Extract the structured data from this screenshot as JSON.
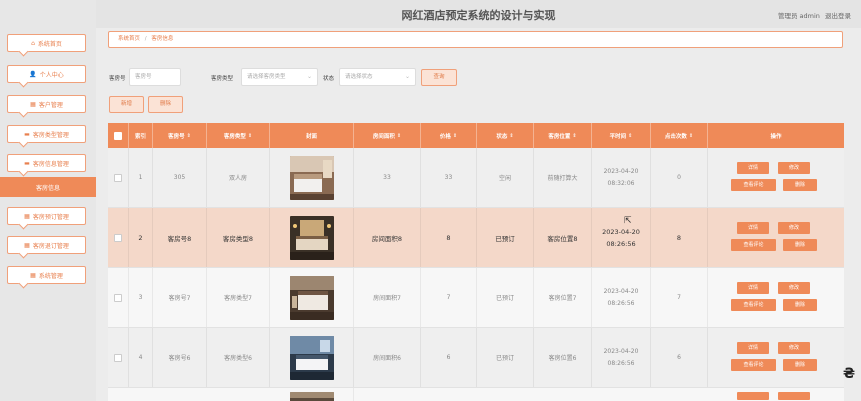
{
  "header": {
    "title": "网红酒店预定系统的设计与实现",
    "user_label": "管理员 admin",
    "logout": "退出登录"
  },
  "sidebar": {
    "items": [
      {
        "label": "系统首页",
        "icon": "home-icon",
        "glyph": "⌂"
      },
      {
        "label": "个人中心",
        "icon": "person-icon",
        "glyph": "👤"
      },
      {
        "label": "客户管理",
        "icon": "grid-icon",
        "glyph": "▦"
      },
      {
        "label": "客房类型管理",
        "icon": "monitor-icon",
        "glyph": "▬"
      },
      {
        "label": "客房信息管理",
        "icon": "monitor-icon",
        "glyph": "▬"
      },
      {
        "label": "客房信息",
        "icon": "",
        "glyph": ""
      },
      {
        "label": "客房预订管理",
        "icon": "grid-icon",
        "glyph": "▦"
      },
      {
        "label": "客房退订管理",
        "icon": "grid-icon",
        "glyph": "▦"
      },
      {
        "label": "系统管理",
        "icon": "grid-icon",
        "glyph": "▦"
      }
    ]
  },
  "breadcrumb": {
    "home": "系统首页",
    "sep": "/",
    "current": "客房信息"
  },
  "search": {
    "room_no_label": "客房号",
    "room_no_placeholder": "客房号",
    "type_label": "客房类型",
    "type_placeholder": "请选择客房类型",
    "status_label": "状态",
    "status_placeholder": "请选择状态",
    "query_button": "查询",
    "add_button": "新增",
    "delete_button": "删除"
  },
  "table": {
    "headers": {
      "index": "索引",
      "room_no": "客房号",
      "room_type": "客房类型",
      "cover": "封面",
      "area": "房间面积",
      "price": "价格",
      "status": "状态",
      "location": "客房位置",
      "time": "平时间",
      "clicks": "点击次数",
      "actions": "操作"
    },
    "sort_glyph": "⇕",
    "actions": {
      "detail": "详情",
      "edit": "修改",
      "view_reviews": "查看评论",
      "delete": "删除"
    },
    "rows": [
      {
        "index": "1",
        "room_no": "305",
        "room_type": "双人房",
        "area": "33",
        "price": "33",
        "status": "空闲",
        "location": "前随打算大",
        "time": "2023-04-20 08:32:06",
        "clicks": "0"
      },
      {
        "index": "2",
        "room_no": "客房号8",
        "room_type": "客房类型8",
        "area": "房间面积8",
        "price": "8",
        "status": "已预订",
        "location": "客房位置8",
        "time": "2023-04-20 08:26:56",
        "clicks": "8"
      },
      {
        "index": "3",
        "room_no": "客房号7",
        "room_type": "客房类型7",
        "area": "房间面积7",
        "price": "7",
        "status": "已预订",
        "location": "客房位置7",
        "time": "2023-04-20 08:26:56",
        "clicks": "7"
      },
      {
        "index": "4",
        "room_no": "客房号6",
        "room_type": "客房类型6",
        "area": "房间面积6",
        "price": "6",
        "status": "已预订",
        "location": "客房位置6",
        "time": "2023-04-20 08:26:56",
        "clicks": "6"
      }
    ]
  },
  "colors": {
    "accent": "#ef8a58",
    "accent_light": "#fbe3d6",
    "row_highlight": "#f4d8c9"
  }
}
